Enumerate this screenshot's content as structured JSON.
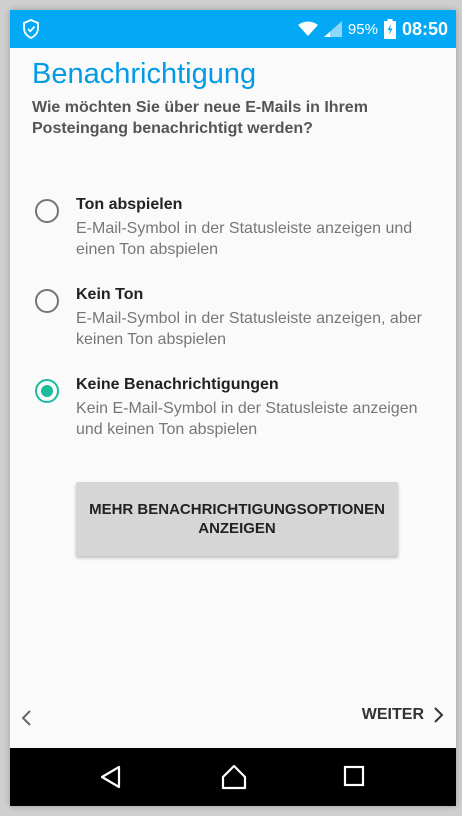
{
  "statusbar": {
    "battery": "95%",
    "time": "08:50"
  },
  "header": {
    "title": "Benachrichtigung",
    "subtitle": "Wie möchten Sie über neue E-Mails in Ihrem Posteingang benachrichtigt werden?"
  },
  "options": [
    {
      "title": "Ton abspielen",
      "description": "E-Mail-Symbol in der Statusleiste anzeigen und einen Ton abspielen",
      "selected": false
    },
    {
      "title": "Kein Ton",
      "description": "E-Mail-Symbol in der Statusleiste anzeigen, aber keinen Ton abspielen",
      "selected": false
    },
    {
      "title": "Keine Benachrichtigungen",
      "description": "Kein E-Mail-Symbol in der Statusleiste anzeigen und keinen Ton abspielen",
      "selected": true
    }
  ],
  "more_button": {
    "label": "MEHR BENACHRICHTIGUNGSOPTIONEN ANZEIGEN"
  },
  "footer": {
    "next_label": "WEITER"
  },
  "colors": {
    "accent": "#03a9f4",
    "title": "#039be5",
    "radio_selected": "#1abc9c",
    "radio_unselected": "#757575"
  },
  "icons": {
    "status_left": "shield-check-icon",
    "wifi": "wifi-icon",
    "signal": "signal-icon",
    "battery": "battery-icon",
    "back": "chevron-left-icon",
    "next": "chevron-right-icon",
    "nav_back": "nav-back-triangle-icon",
    "nav_home": "nav-home-icon",
    "nav_recent": "nav-recent-apps-icon"
  }
}
